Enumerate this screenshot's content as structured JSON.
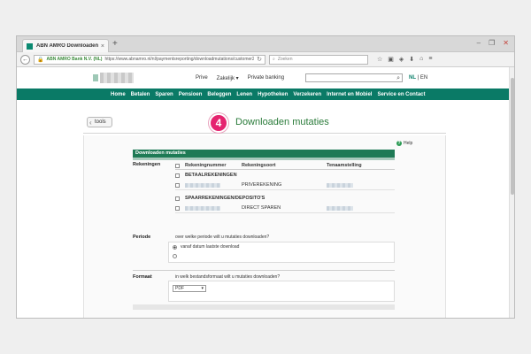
{
  "browser": {
    "tab_title": "ABN AMRO Downloaden ...",
    "tab_close": "×",
    "new_tab": "+",
    "window_controls": [
      "–",
      "❐",
      "✕"
    ],
    "identity": "ABN AMRO Bank N.V. (NL)",
    "url": "https://www.abnamro.nl/nl/paymentsreporting/downloadmutations/customer2007630772.html",
    "search_placeholder": "Zoeken",
    "icons": [
      "star-icon",
      "reading-list-icon",
      "pocket-icon",
      "download-icon",
      "home-icon",
      "menu-icon"
    ]
  },
  "site": {
    "top_links": [
      "Prive",
      "Zakelijk ▾",
      "Private banking"
    ],
    "lang_nl": "NL",
    "lang_sep": " | ",
    "lang_en": "EN",
    "nav": [
      "Home",
      "Betalen",
      "Sparen",
      "Pensioen",
      "Beleggen",
      "Lenen",
      "Hypotheken",
      "Verzekeren",
      "Internet en Mobiel",
      "Service en Contact"
    ]
  },
  "page": {
    "tools_label": "tools",
    "step_number": "4",
    "title": "Downloaden mutaties",
    "help_label": "Help",
    "panel_title": "Downloaden mutaties",
    "accounts_label": "Rekeningen",
    "columns": [
      "Rekeningnummer",
      "Rekeningsoort",
      "Tenaamstelling"
    ],
    "group_current": "BETAALREKENINGEN",
    "current_account_type": "PRIVEREKENING",
    "group_savings": "SPAARREKENINGEN/DEPOSITO'S",
    "savings_account_type": "DIRECT SPAREN",
    "period_label": "Periode",
    "period_question": "over welke periode wilt u mutaties downloaden?",
    "period_option_1": "vanaf datum laatste download",
    "format_label": "Formaat",
    "format_question": "in welk bestandsformaat wilt u mutaties downloaden?",
    "format_selected": "PDF"
  },
  "colors": {
    "brand_green": "#0a7a66",
    "panel_green": "#1e7a55",
    "step_pink": "#e5236f",
    "title_green": "#2a7b3a"
  }
}
